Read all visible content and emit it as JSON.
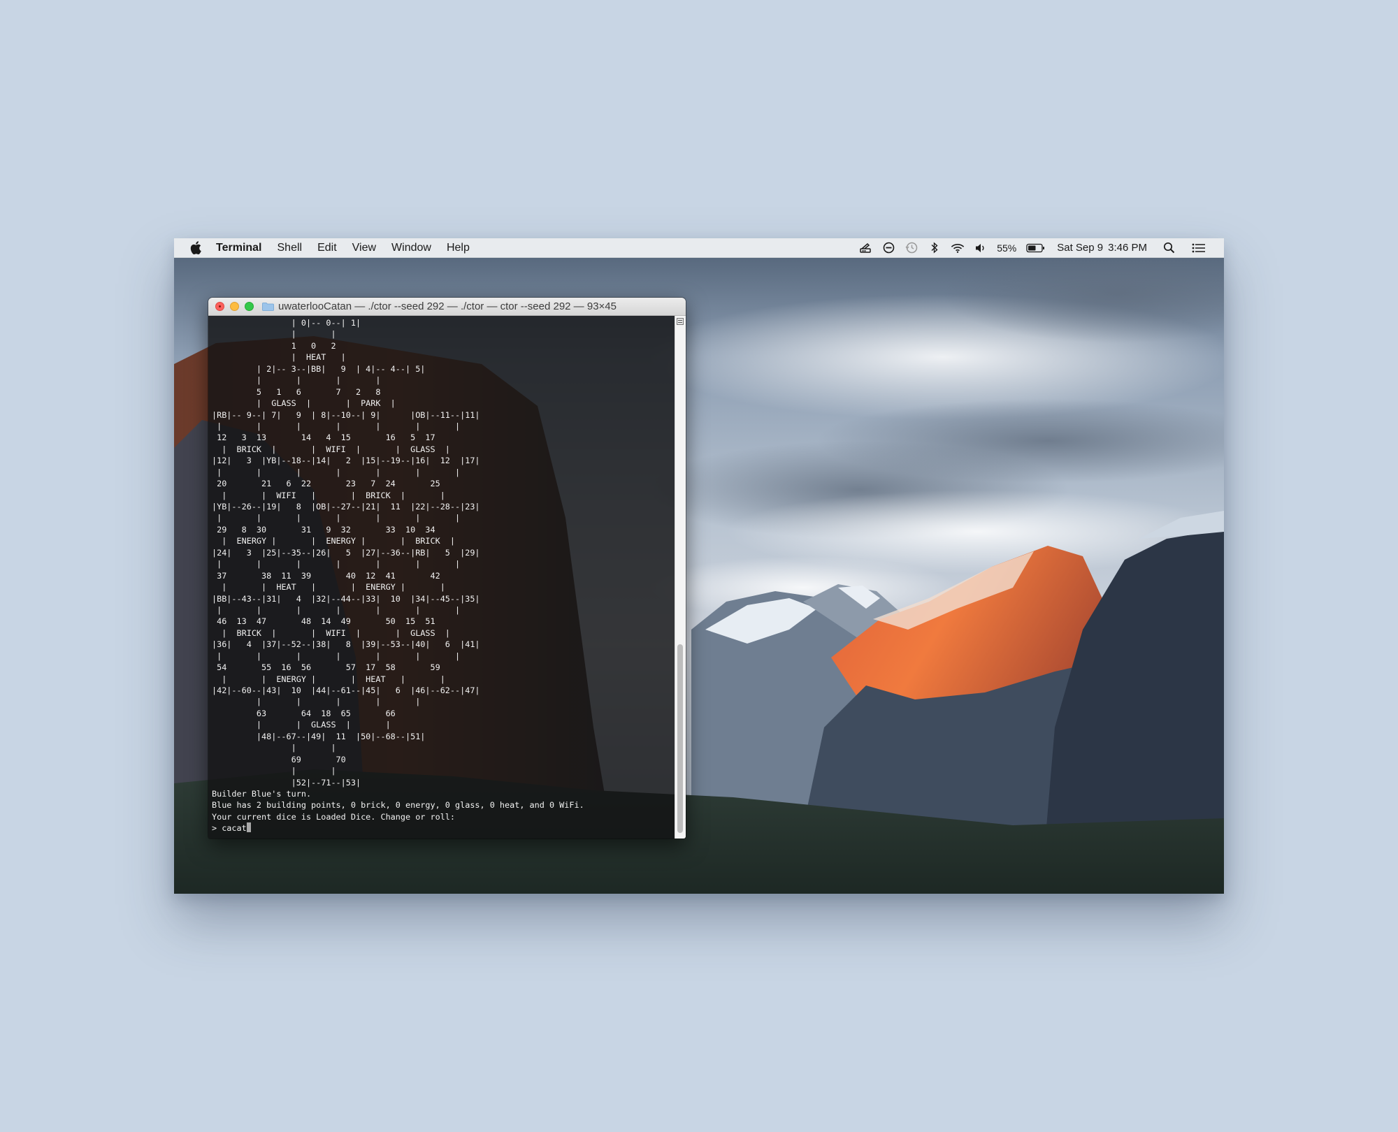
{
  "menubar": {
    "app_name": "Terminal",
    "items": [
      "Shell",
      "Edit",
      "View",
      "Window",
      "Help"
    ],
    "battery_percent": "55%",
    "date": "Sat Sep 9",
    "time": "3:46 PM"
  },
  "terminal": {
    "title": "uwaterlooCatan — ./ctor --seed 292 — ./ctor — ctor --seed 292 — 93×45",
    "lines": [
      "                | 0|-- 0--| 1|",
      "                |       |",
      "                1   0   2",
      "                |  HEAT   |",
      "         | 2|-- 3--|BB|   9  | 4|-- 4--| 5|",
      "         |       |       |       |",
      "         5   1   6       7   2   8",
      "         |  GLASS  |       |  PARK  |",
      "|RB|-- 9--| 7|   9  | 8|--10--| 9|      |OB|--11--|11|",
      " |       |       |       |       |       |       |",
      " 12   3  13       14   4  15       16   5  17",
      "  |  BRICK  |       |  WIFI  |       |  GLASS  |",
      "|12|   3  |YB|--18--|14|   2  |15|--19--|16|  12  |17|",
      " |       |       |       |       |       |       |",
      " 20       21   6  22       23   7  24       25",
      "  |       |  WIFI   |       |  BRICK  |       |",
      "|YB|--26--|19|   8  |OB|--27--|21|  11  |22|--28--|23|",
      " |       |       |       |       |       |       |",
      " 29   8  30       31   9  32       33  10  34",
      "  |  ENERGY |       |  ENERGY |       |  BRICK  |",
      "|24|   3  |25|--35--|26|   5  |27|--36--|RB|   5  |29|",
      " |       |       |       |       |       |       |",
      " 37       38  11  39       40  12  41       42",
      "  |       |  HEAT   |       |  ENERGY |       |",
      "|BB|--43--|31|   4  |32|--44--|33|  10  |34|--45--|35|",
      " |       |       |       |       |       |       |",
      " 46  13  47       48  14  49       50  15  51",
      "  |  BRICK  |       |  WIFI  |       |  GLASS  |",
      "|36|   4  |37|--52--|38|   8  |39|--53--|40|   6  |41|",
      " |       |       |       |       |       |       |",
      " 54       55  16  56       57  17  58       59",
      "  |       |  ENERGY |       |  HEAT   |       |",
      "|42|--60--|43|  10  |44|--61--|45|   6  |46|--62--|47|",
      "         |       |       |       |       |",
      "         63       64  18  65       66",
      "         |       |  GLASS  |       |",
      "         |48|--67--|49|  11  |50|--68--|51|",
      "                |       |",
      "                69       70",
      "                |       |",
      "                |52|--71--|53|",
      "Builder Blue's turn.",
      "Blue has 2 building points, 0 brick, 0 energy, 0 glass, 0 heat, and 0 WiFi.",
      "Your current dice is Loaded Dice. Change or roll:"
    ],
    "prompt": "> cacat"
  }
}
